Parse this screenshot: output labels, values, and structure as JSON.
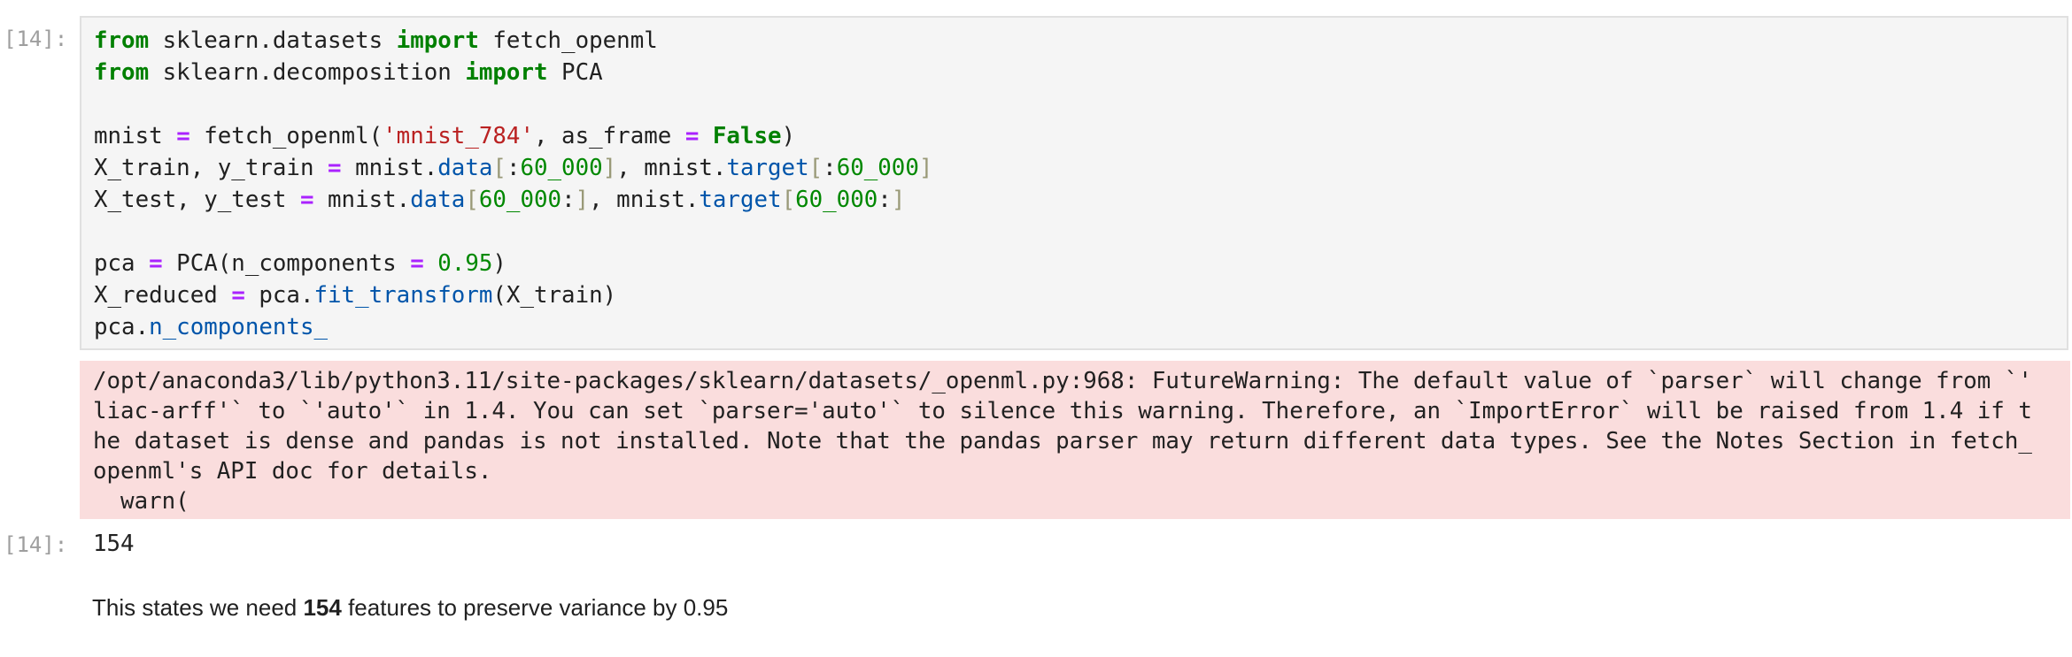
{
  "cell": {
    "prompt_in": "[14]:",
    "prompt_out": "[14]:",
    "code": [
      [
        [
          "kw",
          "from"
        ],
        [
          "t",
          " sklearn.datasets "
        ],
        [
          "kw",
          "import"
        ],
        [
          "t",
          " fetch_openml"
        ]
      ],
      [
        [
          "kw",
          "from"
        ],
        [
          "t",
          " sklearn.decomposition "
        ],
        [
          "kw",
          "import"
        ],
        [
          "t",
          " PCA"
        ]
      ],
      [],
      [
        [
          "t",
          "mnist "
        ],
        [
          "op",
          "="
        ],
        [
          "t",
          " fetch_openml("
        ],
        [
          "str",
          "'mnist_784'"
        ],
        [
          "t",
          ", as_frame "
        ],
        [
          "op",
          "="
        ],
        [
          "t",
          " "
        ],
        [
          "kw",
          "False"
        ],
        [
          "t",
          ")"
        ]
      ],
      [
        [
          "t",
          "X_train, y_train "
        ],
        [
          "op",
          "="
        ],
        [
          "t",
          " mnist."
        ],
        [
          "attr",
          "data"
        ],
        [
          "br",
          "["
        ],
        [
          "t",
          ":"
        ],
        [
          "num",
          "60_000"
        ],
        [
          "br",
          "]"
        ],
        [
          "t",
          ", mnist."
        ],
        [
          "attr",
          "target"
        ],
        [
          "br",
          "["
        ],
        [
          "t",
          ":"
        ],
        [
          "num",
          "60_000"
        ],
        [
          "br",
          "]"
        ]
      ],
      [
        [
          "t",
          "X_test, y_test "
        ],
        [
          "op",
          "="
        ],
        [
          "t",
          " mnist."
        ],
        [
          "attr",
          "data"
        ],
        [
          "br",
          "["
        ],
        [
          "num",
          "60_000"
        ],
        [
          "t",
          ":"
        ],
        [
          "br",
          "]"
        ],
        [
          "t",
          ", mnist."
        ],
        [
          "attr",
          "target"
        ],
        [
          "br",
          "["
        ],
        [
          "num",
          "60_000"
        ],
        [
          "t",
          ":"
        ],
        [
          "br",
          "]"
        ]
      ],
      [],
      [
        [
          "t",
          "pca "
        ],
        [
          "op",
          "="
        ],
        [
          "t",
          " PCA(n_components "
        ],
        [
          "op",
          "="
        ],
        [
          "t",
          " "
        ],
        [
          "num",
          "0.95"
        ],
        [
          "t",
          ")"
        ]
      ],
      [
        [
          "t",
          "X_reduced "
        ],
        [
          "op",
          "="
        ],
        [
          "t",
          " pca."
        ],
        [
          "attr",
          "fit_transform"
        ],
        [
          "t",
          "(X_train)"
        ]
      ],
      [
        [
          "t",
          "pca."
        ],
        [
          "attr",
          "n_components_"
        ]
      ]
    ],
    "warning_lines": [
      "/opt/anaconda3/lib/python3.11/site-packages/sklearn/datasets/_openml.py:968: FutureWarning: The default value of `parser` will change from `'",
      "liac-arff'` to `'auto'` in 1.4. You can set `parser='auto'` to silence this warning. Therefore, an `ImportError` will be raised from 1.4 if t",
      "he dataset is dense and pandas is not installed. Note that the pandas parser may return different data types. See the Notes Section in fetch_",
      "openml's API doc for details.",
      "  warn("
    ],
    "result": "154"
  },
  "markdown": {
    "before": "This states we need ",
    "bold": "154",
    "after": " features to preserve variance by 0.95"
  }
}
